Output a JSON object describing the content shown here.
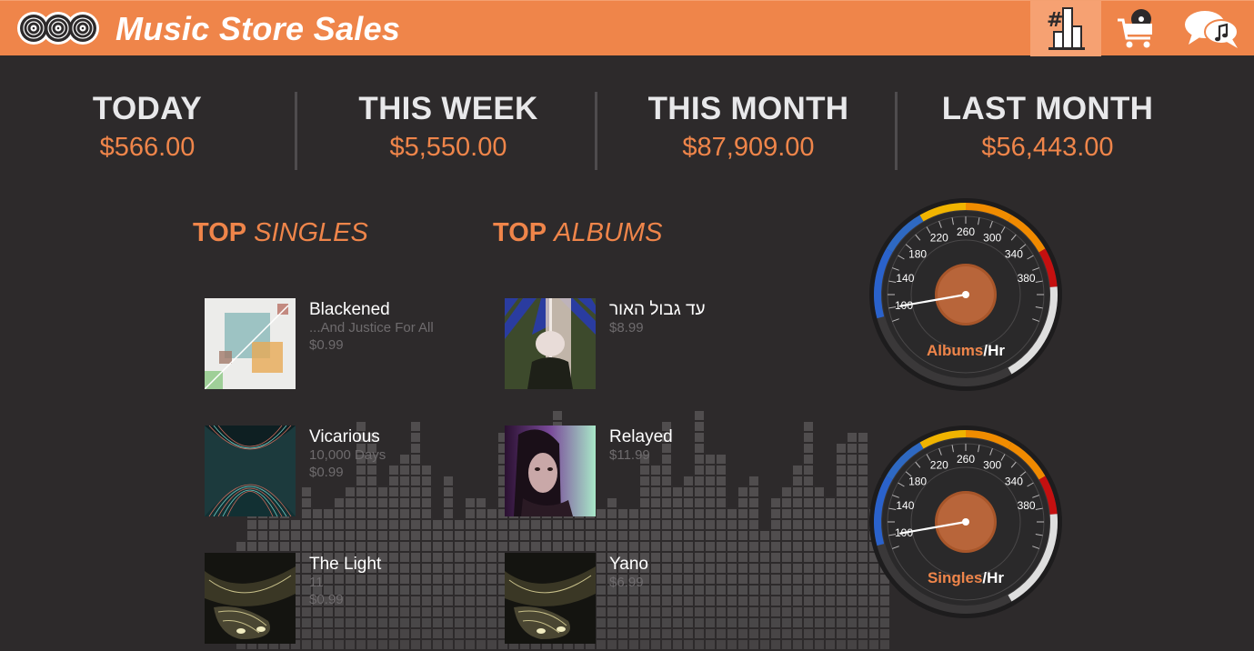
{
  "header": {
    "title": "Music Store Sales",
    "icons": [
      "records-logo-icon",
      "top-chart-icon",
      "cart-record-icon",
      "chat-music-icon"
    ]
  },
  "stats": [
    {
      "label": "TODAY",
      "value": "$566.00"
    },
    {
      "label": "THIS WEEK",
      "value": "$5,550.00"
    },
    {
      "label": "THIS MONTH",
      "value": "$87,909.00"
    },
    {
      "label": "LAST MONTH",
      "value": "$56,443.00"
    }
  ],
  "singles": {
    "title_bold": "TOP",
    "title_italic": "SINGLES",
    "items": [
      {
        "title": "Blackened",
        "album": "...And Justice For All",
        "price": "$0.99"
      },
      {
        "title": "Vicarious",
        "album": "10,000 Days",
        "price": "$0.99"
      },
      {
        "title": "The Light",
        "album": "11",
        "price": "$0.99"
      }
    ]
  },
  "albums": {
    "title_bold": "TOP",
    "title_italic": "ALBUMS",
    "items": [
      {
        "title": "עד גבול האור",
        "price": "$8.99"
      },
      {
        "title": "Relayed",
        "price": "$11.99"
      },
      {
        "title": "Yano",
        "price": "$6.99"
      }
    ]
  },
  "gauges": [
    {
      "name": "albums",
      "label_accent": "Albums",
      "label_rest": "/Hr",
      "ticks": [
        "100",
        "140",
        "180",
        "220",
        "260",
        "300",
        "340",
        "380"
      ],
      "value": 100
    },
    {
      "name": "singles",
      "label_accent": "Singles",
      "label_rest": "/Hr",
      "ticks": [
        "100",
        "140",
        "180",
        "220",
        "260",
        "300",
        "340",
        "380"
      ],
      "value": 100
    }
  ],
  "colors": {
    "accent": "#ef854a",
    "background": "#2d2a2b",
    "header": "#ef854a"
  }
}
